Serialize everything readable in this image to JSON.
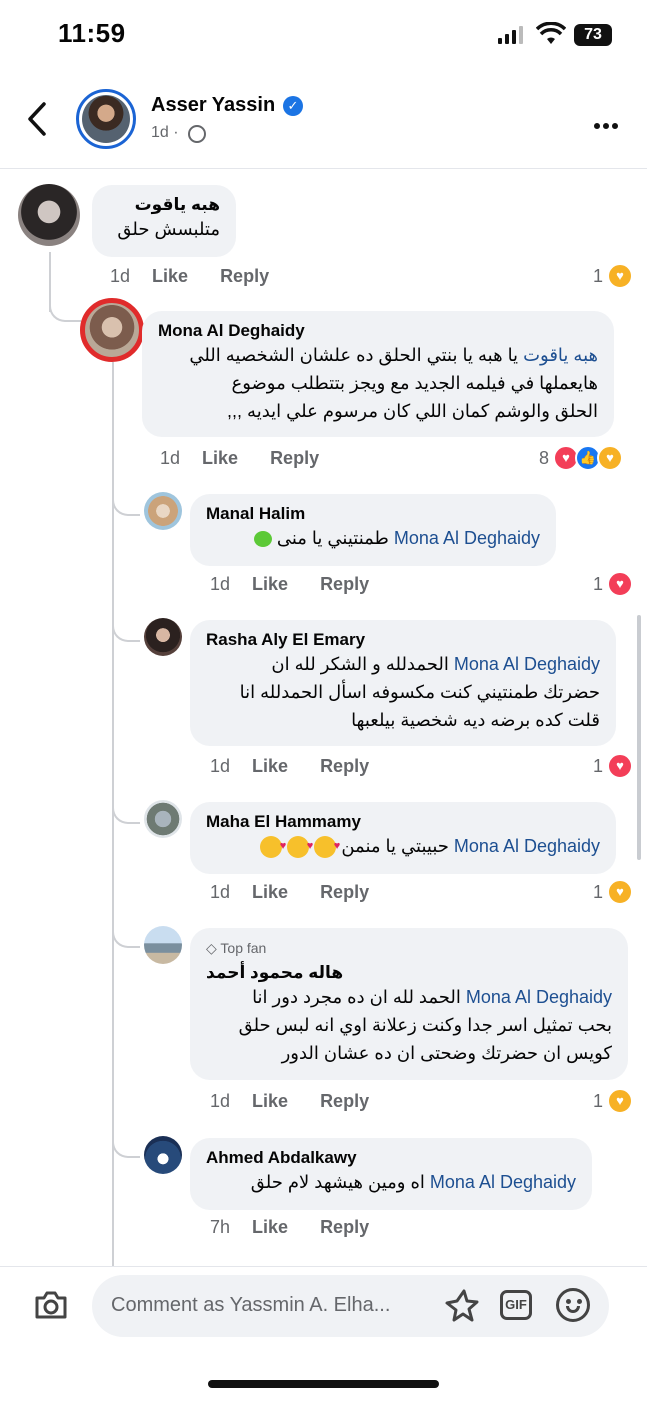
{
  "status_bar": {
    "time": "11:59",
    "battery": "73"
  },
  "post": {
    "author": "Asser Yassin",
    "time": "1d",
    "separator": "·"
  },
  "comments": [
    {
      "id": "c1",
      "name": "هبه ياقوت",
      "lines": [
        "متلبسش حلق"
      ],
      "time": "1d",
      "like": "Like",
      "reply": "Reply",
      "reactions": "1",
      "reaction_icons": [
        "care"
      ]
    },
    {
      "id": "c2",
      "name": "Mona Al Deghaidy",
      "mention": "هبه ياقوت",
      "lines": [
        "يا هبه يا بنتي الحلق ده علشان الشخصيه اللي",
        "هايعملها في فيلمه الجديد مع ويجز بتتطلب موضوع",
        "الحلق والوشم كمان اللي كان مرسوم علي ايديه ,,,"
      ],
      "time": "1d",
      "like": "Like",
      "reply": "Reply",
      "reactions": "8",
      "reaction_icons": [
        "love",
        "like",
        "care"
      ]
    },
    {
      "id": "c3",
      "name": "Manal Halim",
      "mention": "Mona Al Deghaidy",
      "lines": [
        "طمنتيني يا منى"
      ],
      "time": "1d",
      "like": "Like",
      "reply": "Reply",
      "reactions": "1",
      "reaction_icons": [
        "love"
      ]
    },
    {
      "id": "c4",
      "name": "Rasha Aly El Emary",
      "mention": "Mona Al Deghaidy",
      "lines": [
        "الحمدلله و الشكر لله ان",
        "حضرتك طمنتيني كنت مكسوفه اسأل الحمدلله انا",
        "قلت كده برضه ديه شخصية بيلعبها"
      ],
      "time": "1d",
      "like": "Like",
      "reply": "Reply",
      "reactions": "1",
      "reaction_icons": [
        "love"
      ]
    },
    {
      "id": "c5",
      "name": "Maha El Hammamy",
      "mention": "Mona Al Deghaidy",
      "lines": [
        "حبيبتي يا منمن"
      ],
      "time": "1d",
      "like": "Like",
      "reply": "Reply",
      "reactions": "1",
      "reaction_icons": [
        "care"
      ]
    },
    {
      "id": "c6",
      "badge": "Top fan",
      "name": "هاله محمود أحمد",
      "mention": "Mona Al Deghaidy",
      "lines": [
        "الحمد لله ان ده مجرد دور انا",
        "بحب تمثيل اسر جدا وكنت زعلانة اوي انه لبس حلق",
        "كويس ان حضرتك وضحتى ان ده عشان الدور"
      ],
      "time": "1d",
      "like": "Like",
      "reply": "Reply",
      "reactions": "1",
      "reaction_icons": [
        "care"
      ]
    },
    {
      "id": "c7",
      "name": "Ahmed Abdalkawy",
      "mention": "Mona Al Deghaidy",
      "lines": [
        "اه ومين هيشهد لام حلق"
      ],
      "time": "7h",
      "like": "Like",
      "reply": "Reply"
    }
  ],
  "composer": {
    "placeholder": "Comment as Yassmin A. Elha...",
    "gif_label": "GIF"
  },
  "icons": [
    "back-chevron-icon",
    "verified-icon",
    "globe-icon",
    "more-icon",
    "camera-icon",
    "avatar-sticker-icon",
    "gif-icon",
    "emoji-icon"
  ],
  "colors": {
    "mention": "#1d4f91",
    "verified": "#1b74e4",
    "bubble": "#f0f2f5",
    "meta": "#65676b",
    "love": "#f33e58",
    "like": "#1877f2",
    "care": "#f7b125"
  }
}
